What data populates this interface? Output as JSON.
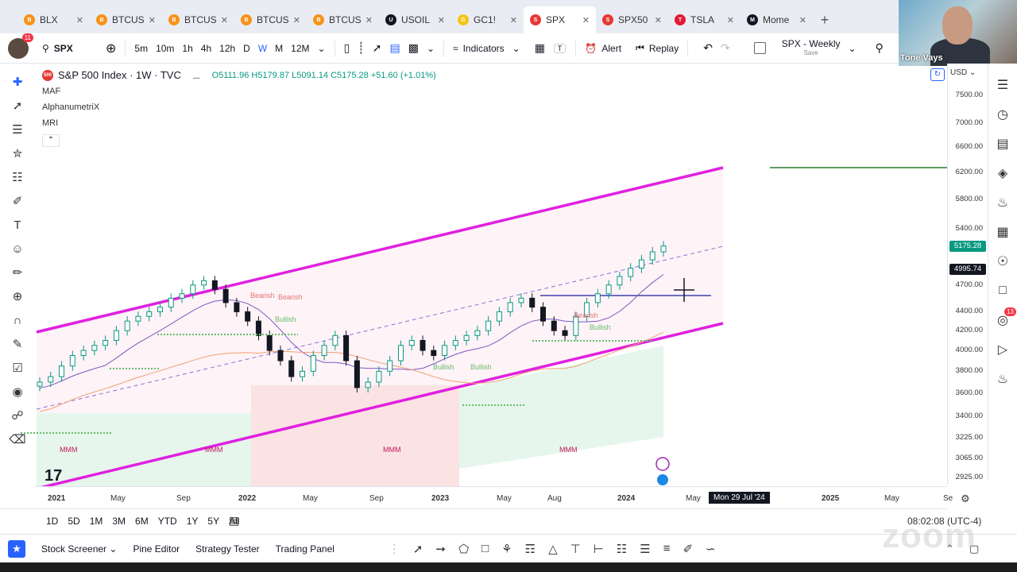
{
  "tabs": [
    {
      "label": "BLX",
      "icon_color": "#f7931a",
      "active": false
    },
    {
      "label": "BTCUS",
      "icon_color": "#f7931a",
      "active": false
    },
    {
      "label": "BTCUS",
      "icon_color": "#f7931a",
      "active": false
    },
    {
      "label": "BTCUS",
      "icon_color": "#f7931a",
      "active": false
    },
    {
      "label": "BTCUS",
      "icon_color": "#f7931a",
      "active": false
    },
    {
      "label": "USOIL",
      "icon_color": "#131722",
      "active": false
    },
    {
      "label": "GC1!",
      "icon_color": "#f5c518",
      "active": false
    },
    {
      "label": "SPX",
      "icon_color": "#e53935",
      "active": true
    },
    {
      "label": "SPX50",
      "icon_color": "#e53935",
      "active": false
    },
    {
      "label": "TSLA",
      "icon_color": "#e31937",
      "active": false
    },
    {
      "label": "Mome",
      "icon_color": "#131722",
      "active": false
    }
  ],
  "webcam": {
    "name": "Tone Vays"
  },
  "toolbar": {
    "avatar_badge": "11",
    "symbol": "SPX",
    "intervals": [
      "5m",
      "10m",
      "1h",
      "4h",
      "12h",
      "D",
      "W",
      "M",
      "12M"
    ],
    "active_interval": "W",
    "indicators_label": "Indicators",
    "alert_label": "Alert",
    "replay_label": "Replay",
    "layout_name": "SPX - Weekly",
    "layout_sub": "Save"
  },
  "legend": {
    "title": "S&P 500 Index · 1W · TVC",
    "ohlc": "O5111.96 H5179.87 L5091.14 C5175.28 +51.60 (+1.01%)",
    "indicators": [
      "MAF",
      "AlphanumetriX",
      "MRI"
    ]
  },
  "price_axis": {
    "currency": "USD",
    "labels": [
      {
        "text": "7500.00",
        "v": 7500
      },
      {
        "text": "7000.00",
        "v": 7000
      },
      {
        "text": "6600.00",
        "v": 6600
      },
      {
        "text": "6200.00",
        "v": 6200
      },
      {
        "text": "5800.00",
        "v": 5800
      },
      {
        "text": "5400.00",
        "v": 5400
      },
      {
        "text": "4700.00",
        "v": 4700
      },
      {
        "text": "4400.00",
        "v": 4400
      },
      {
        "text": "4200.00",
        "v": 4200
      },
      {
        "text": "4000.00",
        "v": 4000
      },
      {
        "text": "3800.00",
        "v": 3800
      },
      {
        "text": "3600.00",
        "v": 3600
      },
      {
        "text": "3400.00",
        "v": 3400
      },
      {
        "text": "3225.00",
        "v": 3225
      },
      {
        "text": "3065.00",
        "v": 3065
      },
      {
        "text": "2925.00",
        "v": 2925
      }
    ],
    "last_price": "5175.28",
    "crosshair_price": "4995.74",
    "last_color": "#089981",
    "crosshair_color": "#131722"
  },
  "time_axis": {
    "labels": [
      "2021",
      "May",
      "Sep",
      "2022",
      "May",
      "Sep",
      "2023",
      "May",
      "Aug",
      "2024",
      "May",
      "2025",
      "May",
      "Se"
    ],
    "crosshair_date": "Mon 29 Jul '24"
  },
  "chart_data": {
    "type": "candlestick",
    "symbol": "SPX",
    "interval": "1W",
    "close": [
      3700,
      3750,
      3850,
      3950,
      4000,
      4050,
      4100,
      4200,
      4300,
      4350,
      4400,
      4450,
      4550,
      4600,
      4700,
      4750,
      4650,
      4500,
      4400,
      4300,
      4150,
      4000,
      3900,
      3750,
      3800,
      3950,
      4050,
      4150,
      3900,
      3650,
      3700,
      3800,
      3900,
      4050,
      4100,
      4000,
      3950,
      4050,
      4100,
      4150,
      4200,
      4300,
      4400,
      4500,
      4550,
      4450,
      4300,
      4200,
      4150,
      4350,
      4500,
      4600,
      4700,
      4800,
      4900,
      5000,
      5100,
      5175
    ],
    "channel_color": "#e020e0",
    "annotations": [
      "Bearish",
      "Bullish",
      "MMM"
    ]
  },
  "range": {
    "buttons": [
      "1D",
      "5D",
      "1M",
      "3M",
      "6M",
      "YTD",
      "1Y",
      "5Y",
      "All"
    ]
  },
  "clock": "08:02:08 (UTC-4)",
  "bottom": {
    "panels": [
      "Stock Screener",
      "Pine Editor",
      "Strategy Tester",
      "Trading Panel"
    ]
  },
  "watermark": "zoom"
}
